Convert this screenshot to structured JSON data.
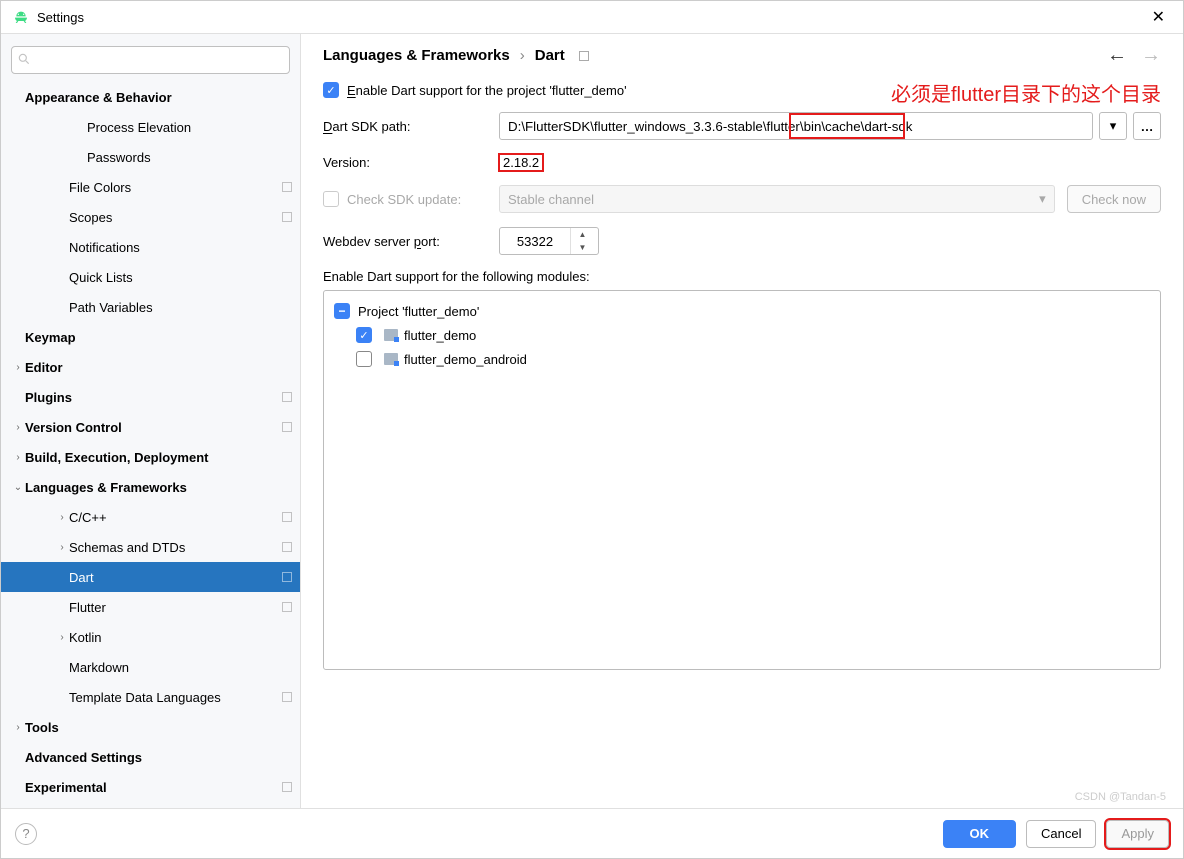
{
  "title": "Settings",
  "breadcrumb": {
    "parent": "Languages & Frameworks",
    "leaf": "Dart"
  },
  "nav": {
    "back": "←",
    "forward": "→"
  },
  "sidebar": {
    "search_placeholder": "",
    "items": [
      {
        "label": "Appearance & Behavior",
        "bold": true,
        "indent": 0,
        "arrow": ""
      },
      {
        "label": "Process Elevation",
        "indent": 3
      },
      {
        "label": "Passwords",
        "indent": 3
      },
      {
        "label": "File Colors",
        "indent": 2,
        "proj": true
      },
      {
        "label": "Scopes",
        "indent": 2,
        "proj": true
      },
      {
        "label": "Notifications",
        "indent": 2
      },
      {
        "label": "Quick Lists",
        "indent": 2
      },
      {
        "label": "Path Variables",
        "indent": 2
      },
      {
        "label": "Keymap",
        "bold": true,
        "indent": 0
      },
      {
        "label": "Editor",
        "bold": true,
        "indent": 0,
        "arrow": "›"
      },
      {
        "label": "Plugins",
        "bold": true,
        "indent": 0,
        "proj": true
      },
      {
        "label": "Version Control",
        "bold": true,
        "indent": 0,
        "arrow": "›",
        "proj": true
      },
      {
        "label": "Build, Execution, Deployment",
        "bold": true,
        "indent": 0,
        "arrow": "›"
      },
      {
        "label": "Languages & Frameworks",
        "bold": true,
        "indent": 0,
        "arrow": "⌄"
      },
      {
        "label": "C/C++",
        "indent": 2,
        "arrow": "›",
        "proj": true
      },
      {
        "label": "Schemas and DTDs",
        "indent": 2,
        "arrow": "›",
        "proj": true
      },
      {
        "label": "Dart",
        "indent": 2,
        "proj": true,
        "selected": true
      },
      {
        "label": "Flutter",
        "indent": 2,
        "proj": true
      },
      {
        "label": "Kotlin",
        "indent": 2,
        "arrow": "›"
      },
      {
        "label": "Markdown",
        "indent": 2
      },
      {
        "label": "Template Data Languages",
        "indent": 2,
        "proj": true
      },
      {
        "label": "Tools",
        "bold": true,
        "indent": 0,
        "arrow": "›"
      },
      {
        "label": "Advanced Settings",
        "bold": true,
        "indent": 0
      },
      {
        "label": "Experimental",
        "bold": true,
        "indent": 0,
        "proj": true
      }
    ]
  },
  "main": {
    "enable_label_pre": "E",
    "enable_label_post": "nable Dart support for the project 'flutter_demo'",
    "annotation": "必须是flutter目录下的这个目录",
    "sdk_label": "Dart SDK path:",
    "sdk_underline": "D",
    "sdk_value": "D:\\FlutterSDK\\flutter_windows_3.3.6-stable\\flutter\\bin\\cache\\dart-sdk",
    "version_label": "Version:",
    "version_value": "2.18.2",
    "check_sdk_label": "Check SDK update:",
    "channel_value": "Stable channel",
    "check_now": "Check now",
    "webdev_label_pre": "Webdev server ",
    "webdev_label_u": "p",
    "webdev_label_post": "ort:",
    "webdev_value": "53322",
    "modules_label": "Enable Dart support for the following modules:",
    "project_label": "Project 'flutter_demo'",
    "modules": [
      {
        "name": "flutter_demo",
        "checked": true
      },
      {
        "name": "flutter_demo_android",
        "checked": false
      }
    ]
  },
  "footer": {
    "ok": "OK",
    "cancel": "Cancel",
    "apply": "Apply"
  },
  "watermark": "CSDN @Tandan-5"
}
